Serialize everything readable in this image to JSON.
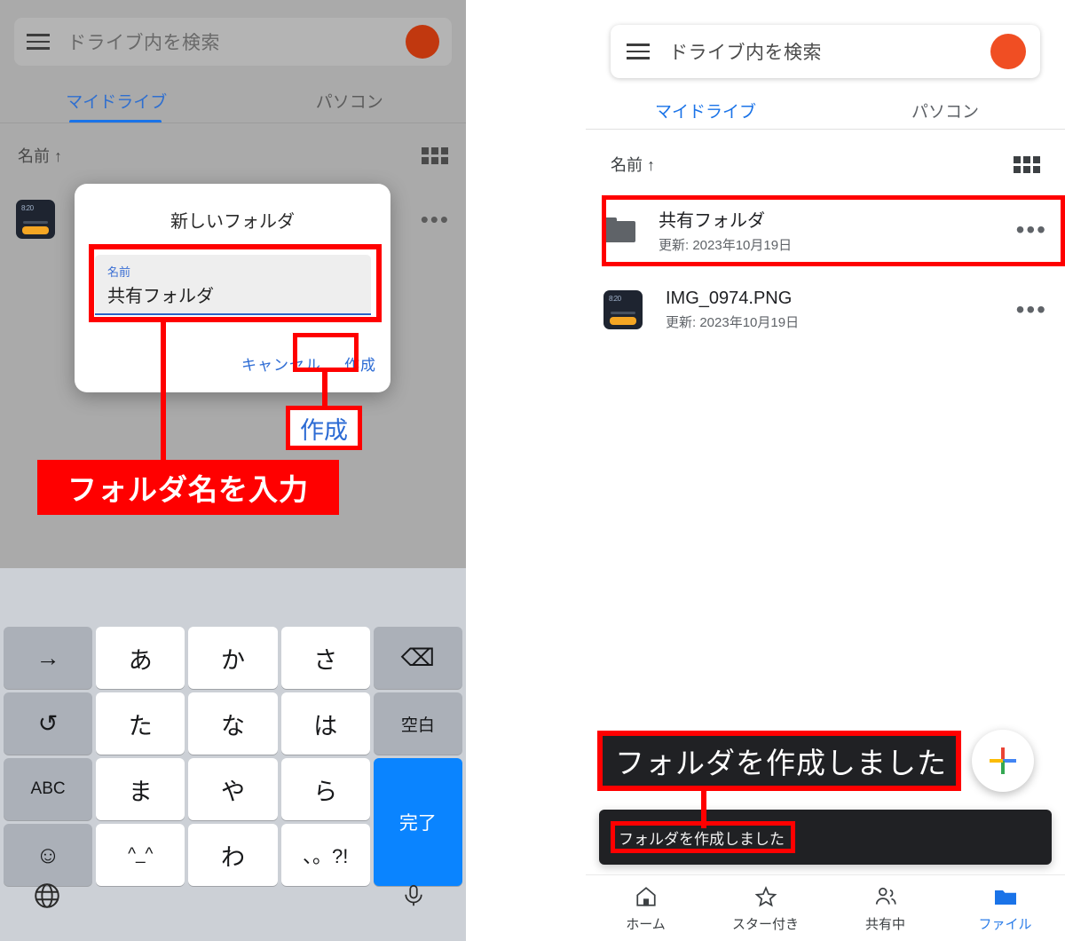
{
  "left_phone": {
    "search": {
      "placeholder": "ドライブ内を検索",
      "menu_icon": "hamburger-menu-icon",
      "avatar": "user-avatar"
    },
    "tabs": [
      {
        "label": "マイドライブ",
        "active": true
      },
      {
        "label": "パソコン",
        "active": false
      }
    ],
    "sort": {
      "label": "名前 ↑",
      "view_icon": "grid-view-icon"
    },
    "background_row": {
      "overflow_icon": "more-options-icon"
    },
    "dialog": {
      "title": "新しいフォルダ",
      "field_label": "名前",
      "field_value": "共有フォルダ",
      "cancel_label": "キャンセル",
      "create_label": "作成"
    },
    "annotations": {
      "create_callout": "作成",
      "input_callout": "フォルダ名を入力"
    },
    "keyboard": {
      "keys": [
        {
          "label": "→",
          "style": "gray"
        },
        {
          "label": "あ",
          "style": "white"
        },
        {
          "label": "か",
          "style": "white"
        },
        {
          "label": "さ",
          "style": "white"
        },
        {
          "label": "⌫",
          "style": "gray"
        },
        {
          "label": "↺",
          "style": "gray"
        },
        {
          "label": "た",
          "style": "white"
        },
        {
          "label": "な",
          "style": "white"
        },
        {
          "label": "は",
          "style": "white"
        },
        {
          "label": "空白",
          "style": "gray-small"
        },
        {
          "label": "ABC",
          "style": "gray-small"
        },
        {
          "label": "ま",
          "style": "white"
        },
        {
          "label": "や",
          "style": "white"
        },
        {
          "label": "ら",
          "style": "white"
        },
        {
          "label": "完了",
          "style": "blue"
        },
        {
          "label": "☺",
          "style": "gray"
        },
        {
          "label": "^_^",
          "style": "white-small"
        },
        {
          "label": "わ",
          "style": "white"
        },
        {
          "label": "、。?!",
          "style": "white-mid"
        }
      ],
      "globe_icon": "globe-language-icon",
      "mic_icon": "microphone-icon"
    }
  },
  "arrow": {
    "name": "right-arrow",
    "color": "#ff0000"
  },
  "right_phone": {
    "search": {
      "placeholder": "ドライブ内を検索",
      "menu_icon": "hamburger-menu-icon",
      "avatar": "user-avatar"
    },
    "tabs": [
      {
        "label": "マイドライブ",
        "active": true
      },
      {
        "label": "パソコン",
        "active": false
      }
    ],
    "sort": {
      "label": "名前 ↑",
      "view_icon": "grid-view-icon"
    },
    "files": [
      {
        "name": "共有フォルダ",
        "subtitle": "更新: 2023年10月19日",
        "icon": "folder-icon",
        "overflow": "more-options-icon",
        "highlighted": true
      },
      {
        "name": "IMG_0974.PNG",
        "subtitle": "更新: 2023年10月19日",
        "icon": "image-thumbnail",
        "overflow": "more-options-icon",
        "highlighted": false
      }
    ],
    "fab": {
      "icon": "google-plus-add-icon"
    },
    "toast": {
      "text": "フォルダを作成しました"
    },
    "annotations": {
      "toast_callout": "フォルダを作成しました"
    },
    "bottom_nav": [
      {
        "label": "ホーム",
        "icon": "home-icon",
        "active": false
      },
      {
        "label": "スター付き",
        "icon": "star-icon",
        "active": false
      },
      {
        "label": "共有中",
        "icon": "people-shared-icon",
        "active": false
      },
      {
        "label": "ファイル",
        "icon": "folder-filled-icon",
        "active": true
      }
    ]
  },
  "colors": {
    "annotation_red": "#ff0000",
    "google_blue": "#1a73e8",
    "avatar_orange": "#f04e23",
    "toast_dark": "#202124"
  }
}
